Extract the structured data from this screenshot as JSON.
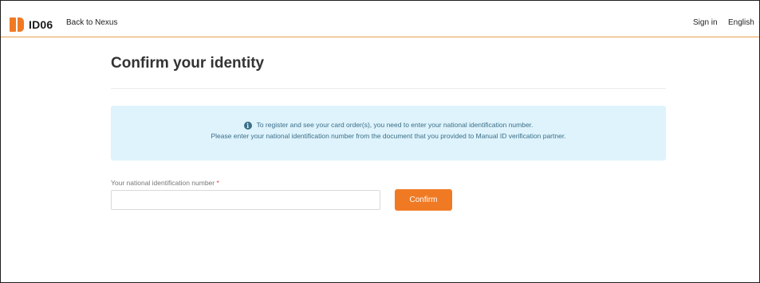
{
  "header": {
    "logo_text": "ID06",
    "back_link": "Back to Nexus",
    "sign_in": "Sign in",
    "language": "English"
  },
  "main": {
    "title": "Confirm your identity",
    "info": {
      "icon": "info-icon",
      "line1": "To register and see your card order(s), you need to enter your national identification number.",
      "line2": "Please enter your national identification number from the document that you provided to Manual ID verification partner."
    },
    "field": {
      "label": "Your national identification number",
      "required_mark": "*",
      "value": "",
      "placeholder": ""
    },
    "confirm_button": "Confirm"
  },
  "colors": {
    "accent": "#f07a24",
    "info_bg": "#def3fc",
    "info_text": "#3b6e87",
    "header_border": "#e8a04a",
    "required": "#e0413a"
  }
}
